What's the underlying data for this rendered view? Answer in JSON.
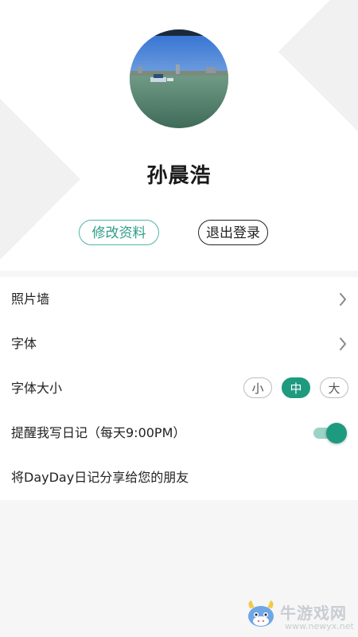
{
  "profile": {
    "name": "孙晨浩",
    "edit_label": "修改资料",
    "logout_label": "退出登录"
  },
  "settings": {
    "photo_wall": "照片墙",
    "font": "字体",
    "font_size": "字体大小",
    "size_options": [
      "小",
      "中",
      "大"
    ],
    "size_selected": "中",
    "reminder": "提醒我写日记（每天9:00PM）",
    "reminder_on": true,
    "share": "将DayDay日记分享给您的朋友"
  },
  "watermark": {
    "name": "牛游戏网",
    "url": "www.newyx.net"
  },
  "colors": {
    "accent": "#1e9a7f",
    "edit_border": "#4fb4a1"
  }
}
